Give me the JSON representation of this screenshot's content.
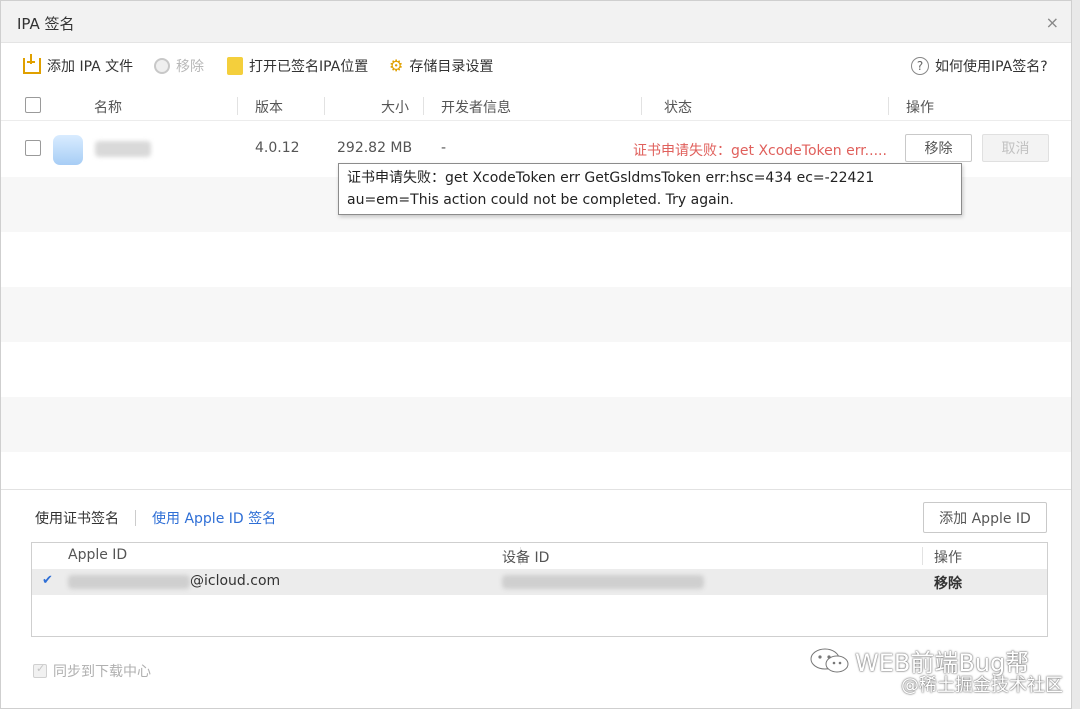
{
  "window": {
    "title": "IPA 签名",
    "close_glyph": "×"
  },
  "toolbar": {
    "add_ipa": "添加 IPA 文件",
    "remove": "移除",
    "open_signed": "打开已签名IPA位置",
    "storage_settings": "存储目录设置",
    "help": "如何使用IPA签名?",
    "help_glyph": "?",
    "icons": {
      "add": "add-file-icon",
      "remove": "remove-circle-icon",
      "open": "folder-icon",
      "settings": "gear-icon",
      "help": "help-circle-icon"
    }
  },
  "table": {
    "headers": {
      "name": "名称",
      "version": "版本",
      "size": "大小",
      "developer": "开发者信息",
      "status": "状态",
      "actions": "操作"
    },
    "rows": [
      {
        "version": "4.0.12",
        "size": "292.82 MB",
        "developer": "-",
        "status": "证书申请失败：get XcodeToken err.....",
        "remove_label": "移除",
        "cancel_label": "取消"
      }
    ]
  },
  "tooltip": {
    "text": "证书申请失败：get XcodeToken err GetGsldmsToken err:hsc=434 ec=-22421 au=em=This action could not be completed. Try again."
  },
  "signing": {
    "tab_certificate": "使用证书签名",
    "tab_apple_id": "使用 Apple ID 签名",
    "add_apple_id": "添加 Apple ID",
    "headers": {
      "apple_id": "Apple ID",
      "device_id": "设备 ID",
      "actions": "操作"
    },
    "rows": [
      {
        "apple_id_suffix": "@icloud.com",
        "action": "移除",
        "check_glyph": "✔"
      }
    ]
  },
  "footer": {
    "sync_label": "同步到下载中心"
  },
  "watermark": {
    "line1": "WEB前端Bug帮",
    "line2": "@稀土掘金技术社区"
  },
  "colors": {
    "accent_blue": "#2f6fd6",
    "error_red": "#e0605c",
    "icon_orange": "#e0a000"
  }
}
